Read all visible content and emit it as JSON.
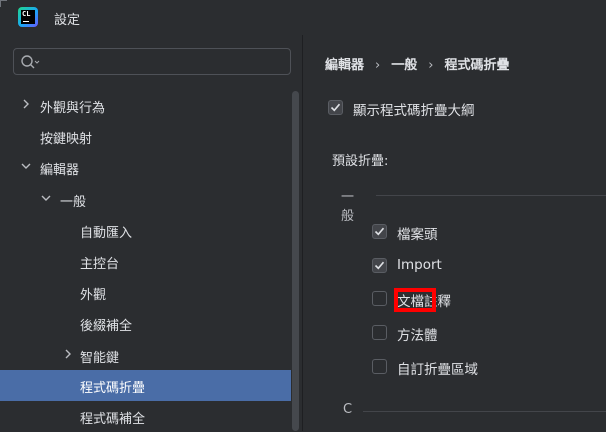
{
  "window": {
    "title": "設定"
  },
  "search": {
    "placeholder": ""
  },
  "tree": [
    {
      "label": "外觀與行為",
      "level": 0,
      "expanded": false,
      "has_children": true,
      "selected": false
    },
    {
      "label": "按鍵映射",
      "level": 0,
      "expanded": false,
      "has_children": false,
      "selected": false
    },
    {
      "label": "編輯器",
      "level": 0,
      "expanded": true,
      "has_children": true,
      "selected": false
    },
    {
      "label": "一般",
      "level": 1,
      "expanded": true,
      "has_children": true,
      "selected": false
    },
    {
      "label": "自動匯入",
      "level": 2,
      "has_children": false,
      "selected": false
    },
    {
      "label": "主控台",
      "level": 2,
      "has_children": false,
      "selected": false
    },
    {
      "label": "外觀",
      "level": 2,
      "has_children": false,
      "selected": false
    },
    {
      "label": "後綴補全",
      "level": 2,
      "has_children": false,
      "selected": false
    },
    {
      "label": "智能鍵",
      "level": 2,
      "expanded": false,
      "has_children": true,
      "selected": false
    },
    {
      "label": "程式碼折疊",
      "level": 2,
      "has_children": false,
      "selected": true
    },
    {
      "label": "程式碼補全",
      "level": 2,
      "has_children": false,
      "selected": false
    }
  ],
  "breadcrumb": [
    "編輯器",
    "一般",
    "程式碼折疊"
  ],
  "settings": {
    "show_outline": {
      "label": "顯示程式碼折疊大綱",
      "checked": true
    },
    "default_fold_label": "預設折疊:",
    "groups": [
      {
        "title": "一般",
        "options": [
          {
            "label": "檔案頭",
            "checked": true
          },
          {
            "label": "Import",
            "checked": true
          },
          {
            "label": "文檔註釋",
            "checked": false
          },
          {
            "label": "方法體",
            "checked": false
          },
          {
            "label": "自訂折疊區域",
            "checked": false
          }
        ]
      },
      {
        "title": "C",
        "options": []
      }
    ]
  },
  "colors": {
    "background": "#2b2d30",
    "selection": "#4a6da7",
    "highlight_box": "#ff0000",
    "text": "#dfe1e5"
  }
}
